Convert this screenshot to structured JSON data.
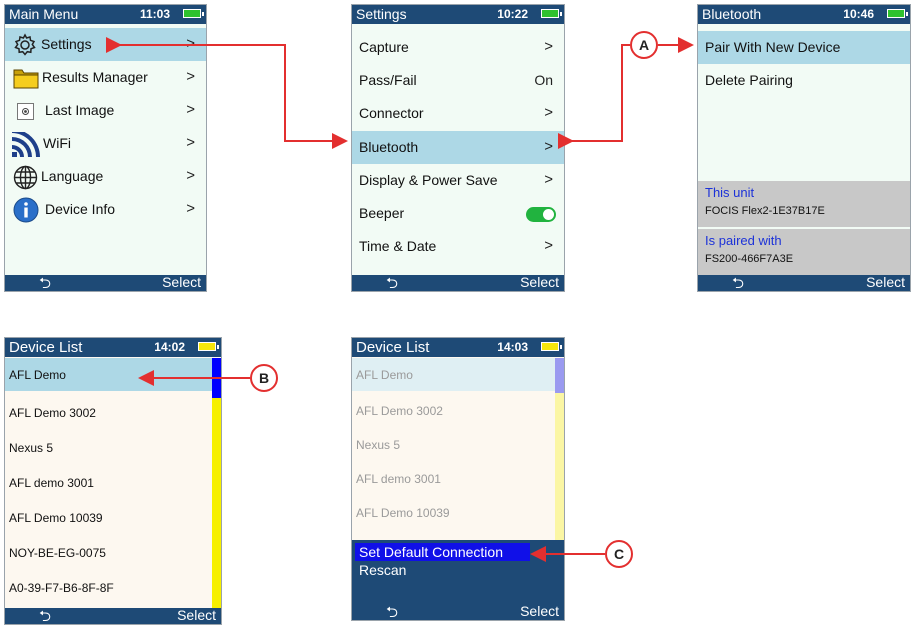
{
  "main_menu": {
    "title": "Main Menu",
    "time": "11:03",
    "items": [
      {
        "label": "Settings",
        "chev": ">"
      },
      {
        "label": "Results Manager",
        "chev": ">"
      },
      {
        "label": "Last Image",
        "chev": ">"
      },
      {
        "label": "WiFi",
        "chev": ">"
      },
      {
        "label": "Language",
        "chev": ">"
      },
      {
        "label": "Device Info",
        "chev": ">"
      }
    ],
    "back": "⮌",
    "select": "Select"
  },
  "settings": {
    "title": "Settings",
    "time": "10:22",
    "items": [
      {
        "label": "Capture",
        "chev": ">"
      },
      {
        "label": "Pass/Fail",
        "value": "On"
      },
      {
        "label": "Connector",
        "chev": ">"
      },
      {
        "label": "Bluetooth",
        "chev": ">"
      },
      {
        "label": "Display & Power Save",
        "chev": ">"
      },
      {
        "label": "Beeper"
      },
      {
        "label": "Time & Date",
        "chev": ">"
      }
    ],
    "beeper_on": true,
    "back": "⮌",
    "select": "Select"
  },
  "bluetooth": {
    "title": "Bluetooth",
    "time": "10:46",
    "items": [
      {
        "label": "Pair With New Device"
      },
      {
        "label": "Delete Pairing"
      }
    ],
    "this_unit_label": "This unit",
    "this_unit_value": "FOCIS Flex2-1E37B17E",
    "paired_label": "Is paired with",
    "paired_value": "FS200-466F7A3E",
    "back": "⮌",
    "select": "Select"
  },
  "device_list_1": {
    "title": "Device List",
    "time": "14:02",
    "devices": [
      "AFL Demo",
      "AFL Demo 3002",
      "Nexus 5",
      "AFL demo 3001",
      "AFL Demo 10039",
      "NOY-BE-EG-0075",
      "A0-39-F7-B6-8F-8F"
    ],
    "back": "⮌",
    "select": "Select"
  },
  "device_list_2": {
    "title": "Device List",
    "time": "14:03",
    "devices": [
      "AFL Demo",
      "AFL Demo 3002",
      "Nexus 5",
      "AFL demo 3001",
      "AFL Demo 10039"
    ],
    "menu": [
      "Set Default Connection",
      "Rescan"
    ],
    "back": "⮌",
    "select": "Select"
  },
  "callouts": {
    "a": "A",
    "b": "B",
    "c": "C"
  },
  "colors": {
    "accent_red": "#e32f2f",
    "titlebar": "#1e4a76",
    "highlight": "#add8e6",
    "scroll_yellow": "#f6f000",
    "scroll_blue": "#0000ff"
  }
}
